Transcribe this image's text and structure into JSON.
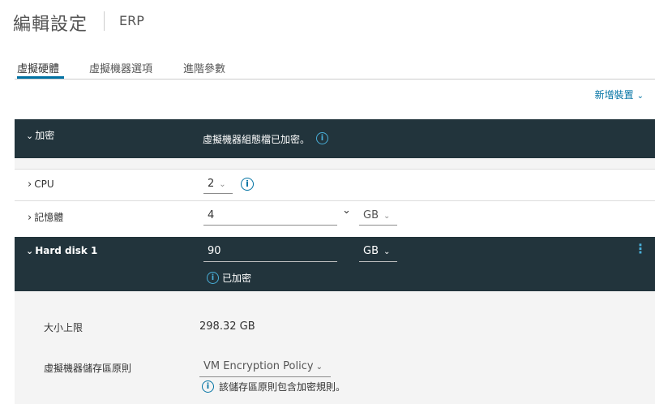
{
  "header": {
    "title": "編輯設定",
    "subtitle": "ERP"
  },
  "tabs": [
    {
      "label": "虛擬硬體",
      "active": true
    },
    {
      "label": "虛擬機器選項",
      "active": false
    },
    {
      "label": "進階參數",
      "active": false
    }
  ],
  "add_device": {
    "label": "新增裝置",
    "chevron": "⌄"
  },
  "encryption": {
    "label": "加密",
    "chevron": "⌄",
    "status": "虛擬機器組態檔已加密。",
    "info_icon": "i"
  },
  "cpu": {
    "label": "CPU",
    "chevron": "›",
    "value": "2",
    "dropdown_chevron": "⌄",
    "info_icon": "i"
  },
  "memory": {
    "label": "記憶體",
    "chevron": "›",
    "value": "4",
    "unit": "GB",
    "step_chevron": "⌄",
    "unit_chevron": "⌄"
  },
  "hard_disk": {
    "label": "Hard disk 1",
    "chevron": "⌄",
    "value": "90",
    "unit": "GB",
    "unit_chevron": "⌄",
    "status": "已加密",
    "info_icon": "i",
    "kebab": "⋮",
    "details": {
      "max_size_label": "大小上限",
      "max_size_value": "298.32 GB",
      "policy_label": "虛擬機器儲存區原則",
      "policy_value": "VM Encryption Policy",
      "policy_chevron": "⌄",
      "policy_note": "該儲存區原則包含加密規則。",
      "info_icon": "i"
    }
  },
  "colors": {
    "dark_row": "#22343c",
    "accent": "#0072a3",
    "accent_light": "#49afd9",
    "detail_bg": "#f4f4f4"
  }
}
